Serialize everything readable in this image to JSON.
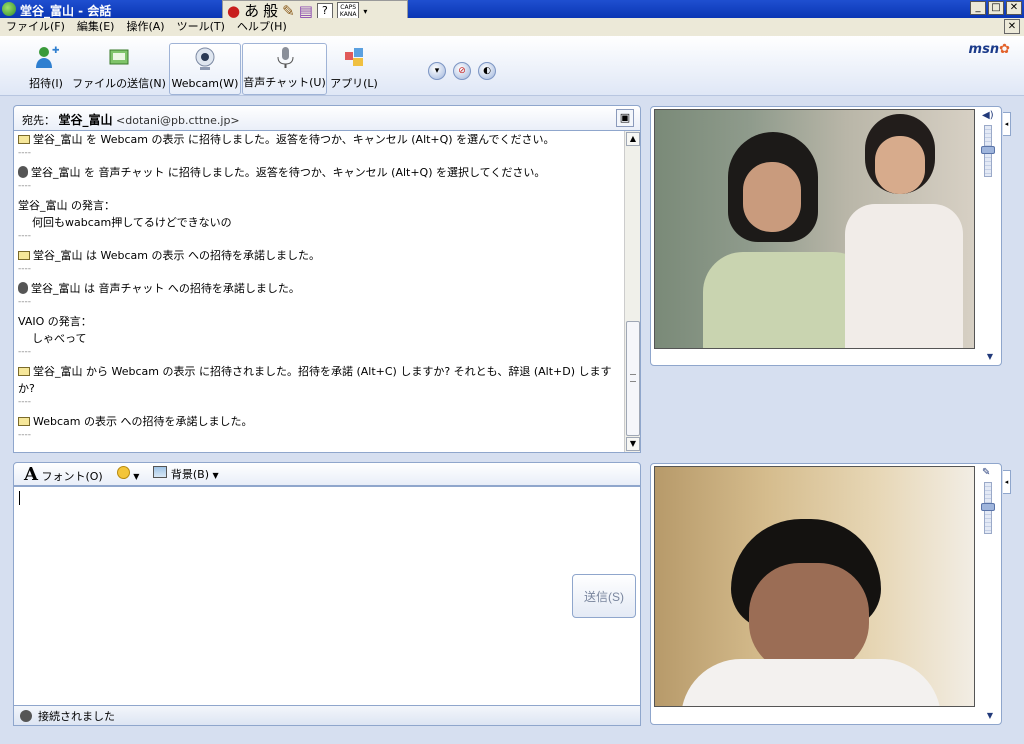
{
  "window": {
    "title": "堂谷_富山 - 会話",
    "menu": [
      "ファイル(F)",
      "編集(E)",
      "操作(A)",
      "ツール(T)",
      "ヘルプ(H)"
    ]
  },
  "ime": {
    "glyph_a": "あ",
    "glyph_b": "般",
    "caps": "CAPS",
    "kana": "KANA",
    "help": "?"
  },
  "toolbar": {
    "buttons": [
      {
        "label": "招待(I)",
        "icon": "invite-icon"
      },
      {
        "label": "ファイルの送信(N)",
        "icon": "send-file-icon"
      },
      {
        "label": "Webcam(W)",
        "icon": "webcam-icon"
      },
      {
        "label": "音声チャット(U)",
        "icon": "microphone-icon"
      },
      {
        "label": "アプリ(L)",
        "icon": "apps-icon"
      }
    ],
    "brand": "msn"
  },
  "conversation": {
    "to_label": "宛先：",
    "contact_name": "堂谷_富山",
    "contact_email": "<dotani@pb.cttne.jp>",
    "messages": [
      {
        "type": "system",
        "icon": "envelope-icon",
        "text": "堂谷_富山 を Webcam の表示 に招待しました。返答を待つか、キャンセル (Alt+Q) を選んでください。"
      },
      {
        "type": "system",
        "icon": "microphone-icon",
        "text": "堂谷_富山 を 音声チャット に招待しました。返答を待つか、キャンセル (Alt+Q) を選択してください。"
      },
      {
        "type": "chat",
        "header": "堂谷_富山 の発言：",
        "text": "何回もwabcam押してるけどできないの"
      },
      {
        "type": "system",
        "icon": "envelope-icon",
        "text": "堂谷_富山 は Webcam の表示 への招待を承諾しました。"
      },
      {
        "type": "system",
        "icon": "microphone-icon",
        "text": "堂谷_富山 は 音声チャット への招待を承諾しました。"
      },
      {
        "type": "chat",
        "header": "VAIO の発言：",
        "text": "しゃべって"
      },
      {
        "type": "system",
        "icon": "envelope-icon",
        "text": "堂谷_富山 から Webcam の表示 に招待されました。招待を承諾 (Alt+C) しますか? それとも、辞退 (Alt+D) しますか?"
      },
      {
        "type": "system",
        "icon": "envelope-icon",
        "text": "Webcam の表示 への招待を承諾しました。"
      }
    ],
    "separator": "----"
  },
  "compose": {
    "font_label": "フォント(O)",
    "background_label": "背景(B)",
    "send_label": "送信(S)",
    "value": ""
  },
  "status": {
    "text": "接続されました"
  }
}
